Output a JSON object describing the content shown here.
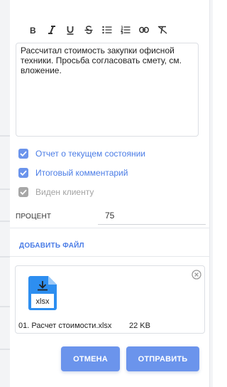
{
  "toolbar": {
    "items": [
      {
        "name": "bold",
        "icon": "bold-icon"
      },
      {
        "name": "italic",
        "icon": "italic-icon"
      },
      {
        "name": "underline",
        "icon": "underline-icon"
      },
      {
        "name": "strikethrough",
        "icon": "strikethrough-icon"
      },
      {
        "name": "bulleted-list",
        "icon": "bulleted-list-icon"
      },
      {
        "name": "numbered-list",
        "icon": "numbered-list-icon"
      },
      {
        "name": "link",
        "icon": "link-icon"
      },
      {
        "name": "clear-format",
        "icon": "clear-format-icon"
      }
    ]
  },
  "editor": {
    "text": "Рассчитал стоимость закупки офисной техники. Просьба согласовать смету, см. вложение."
  },
  "checkboxes": [
    {
      "label": "Отчет о текущем состоянии",
      "checked": true,
      "enabled": true
    },
    {
      "label": "Итоговый комментарий",
      "checked": true,
      "enabled": true
    },
    {
      "label": "Виден клиенту",
      "checked": true,
      "enabled": false
    }
  ],
  "percent": {
    "label": "ПРОЦЕНТ",
    "value": "75"
  },
  "add_file_label": "ДОБАВИТЬ ФАЙЛ",
  "attachment": {
    "icon_label": "xlsx",
    "name": "01. Расчет стоимости.xlsx",
    "size": "22 KB"
  },
  "buttons": {
    "cancel": "ОТМЕНА",
    "send": "ОТПРАВИТЬ"
  },
  "colors": {
    "accent": "#6b94ec",
    "link": "#4a7ce6",
    "file_icon": "#2d8ef0",
    "disabled": "#a7a7a7"
  }
}
